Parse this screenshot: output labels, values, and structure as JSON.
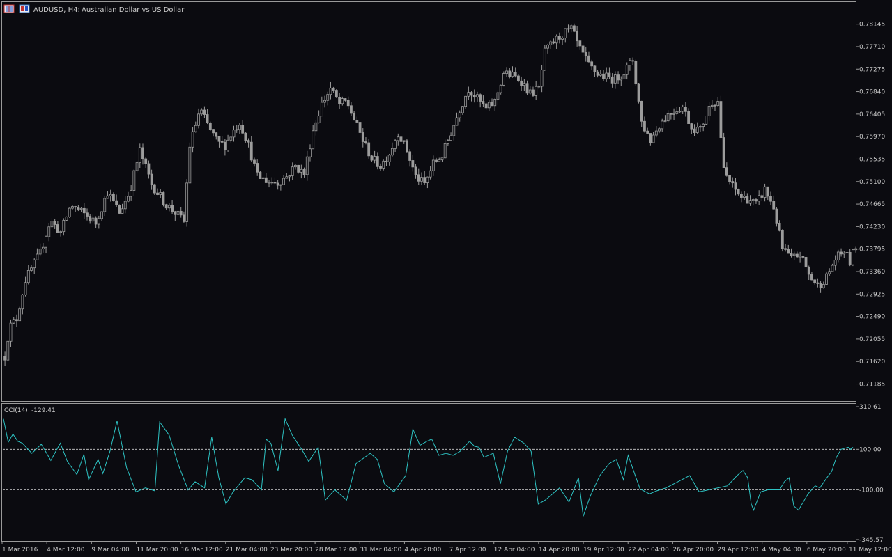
{
  "header": {
    "symbol_timeframe": "AUDUSD, H4:",
    "description": "Australian Dollar vs US Dollar",
    "icons": [
      "chart-grid-icon",
      "one-click-trading-icon"
    ]
  },
  "indicator": {
    "name": "CCI(14)",
    "value": "-129.41"
  },
  "colors": {
    "background": "#0b0b10",
    "candle": "#9c9c9c",
    "cci_line": "#2ec4c4",
    "levels": "#d0d0d0",
    "text": "#c8c8c8",
    "border": "#9a9a9a"
  },
  "chart_data": [
    {
      "type": "candlestick",
      "symbol": "AUDUSD",
      "timeframe": "H4",
      "price_axis_ticks": [
        "0.78145",
        "0.77710",
        "0.77275",
        "0.76840",
        "0.76405",
        "0.75970",
        "0.75535",
        "0.75100",
        "0.74665",
        "0.74230",
        "0.73795",
        "0.73360",
        "0.72925",
        "0.72490",
        "0.72055",
        "0.71620",
        "0.71185"
      ],
      "time_axis_ticks": [
        "1 Mar 2016",
        "4 Mar 12:00",
        "9 Mar 04:00",
        "11 Mar 20:00",
        "16 Mar 12:00",
        "21 Mar 04:00",
        "23 Mar 20:00",
        "28 Mar 12:00",
        "31 Mar 04:00",
        "4 Apr 20:00",
        "7 Apr 12:00",
        "12 Apr 04:00",
        "14 Apr 20:00",
        "19 Apr 12:00",
        "22 Apr 04:00",
        "26 Apr 20:00",
        "29 Apr 12:00",
        "4 May 04:00",
        "6 May 20:00",
        "11 May 12:00"
      ],
      "ylim": [
        0.7099,
        0.7845
      ],
      "close_path": [
        [
          0,
          0.7172
        ],
        [
          3,
          0.7228
        ],
        [
          8,
          0.7245
        ],
        [
          14,
          0.732
        ],
        [
          24,
          0.7372
        ],
        [
          31,
          0.7435
        ],
        [
          38,
          0.7412
        ],
        [
          45,
          0.7465
        ],
        [
          55,
          0.7445
        ],
        [
          62,
          0.743
        ],
        [
          70,
          0.749
        ],
        [
          78,
          0.745
        ],
        [
          85,
          0.749
        ],
        [
          92,
          0.757
        ],
        [
          100,
          0.7505
        ],
        [
          110,
          0.7465
        ],
        [
          118,
          0.7445
        ],
        [
          122,
          0.7432
        ],
        [
          126,
          0.758
        ],
        [
          133,
          0.765
        ],
        [
          138,
          0.762
        ],
        [
          145,
          0.7585
        ],
        [
          150,
          0.758
        ],
        [
          155,
          0.7605
        ],
        [
          160,
          0.7625
        ],
        [
          165,
          0.759
        ],
        [
          172,
          0.752
        ],
        [
          180,
          0.751
        ],
        [
          186,
          0.7508
        ],
        [
          192,
          0.752
        ],
        [
          198,
          0.754
        ],
        [
          204,
          0.7525
        ],
        [
          210,
          0.761
        ],
        [
          216,
          0.766
        ],
        [
          222,
          0.769
        ],
        [
          228,
          0.766
        ],
        [
          233,
          0.7665
        ],
        [
          238,
          0.763
        ],
        [
          244,
          0.759
        ],
        [
          250,
          0.7555
        ],
        [
          256,
          0.754
        ],
        [
          262,
          0.7565
        ],
        [
          268,
          0.7605
        ],
        [
          274,
          0.757
        ],
        [
          280,
          0.752
        ],
        [
          286,
          0.7505
        ],
        [
          292,
          0.7545
        ],
        [
          298,
          0.756
        ],
        [
          304,
          0.7605
        ],
        [
          310,
          0.765
        ],
        [
          316,
          0.769
        ],
        [
          322,
          0.767
        ],
        [
          328,
          0.765
        ],
        [
          334,
          0.7665
        ],
        [
          340,
          0.772
        ],
        [
          346,
          0.7715
        ],
        [
          352,
          0.7705
        ],
        [
          358,
          0.768
        ],
        [
          364,
          0.769
        ],
        [
          368,
          0.776
        ],
        [
          374,
          0.778
        ],
        [
          380,
          0.7795
        ],
        [
          386,
          0.7805
        ],
        [
          392,
          0.7765
        ],
        [
          398,
          0.7735
        ],
        [
          404,
          0.7718
        ],
        [
          410,
          0.7712
        ],
        [
          416,
          0.7708
        ],
        [
          422,
          0.7722
        ],
        [
          428,
          0.7745
        ],
        [
          434,
          0.7625
        ],
        [
          440,
          0.759
        ],
        [
          446,
          0.762
        ],
        [
          452,
          0.764
        ],
        [
          458,
          0.765
        ],
        [
          462,
          0.7655
        ],
        [
          468,
          0.7615
        ],
        [
          474,
          0.761
        ],
        [
          478,
          0.764
        ],
        [
          482,
          0.7665
        ],
        [
          486,
          0.7665
        ],
        [
          490,
          0.753
        ],
        [
          496,
          0.75
        ],
        [
          502,
          0.748
        ],
        [
          508,
          0.7475
        ],
        [
          512,
          0.7465
        ],
        [
          518,
          0.7495
        ],
        [
          524,
          0.746
        ],
        [
          530,
          0.738
        ],
        [
          536,
          0.736
        ],
        [
          542,
          0.737
        ],
        [
          548,
          0.733
        ],
        [
          554,
          0.7308
        ],
        [
          560,
          0.7325
        ],
        [
          566,
          0.736
        ],
        [
          572,
          0.7375
        ],
        [
          576,
          0.7355
        ],
        [
          580,
          0.7385
        ]
      ]
    },
    {
      "type": "line",
      "name": "CCI(14)",
      "last_value": -129.41,
      "ylim": [
        -345.57,
        310.61
      ],
      "axis_ticks": [
        "310.61",
        "100.00",
        "-100.00",
        "-345.57"
      ],
      "levels": [
        100,
        -100
      ],
      "series_path": [
        [
          0,
          250
        ],
        [
          4,
          135
        ],
        [
          8,
          175
        ],
        [
          12,
          140
        ],
        [
          16,
          130
        ],
        [
          24,
          80
        ],
        [
          32,
          125
        ],
        [
          40,
          45
        ],
        [
          48,
          130
        ],
        [
          54,
          40
        ],
        [
          62,
          -25
        ],
        [
          68,
          75
        ],
        [
          72,
          -50
        ],
        [
          80,
          50
        ],
        [
          84,
          -20
        ],
        [
          90,
          90
        ],
        [
          96,
          240
        ],
        [
          104,
          10
        ],
        [
          112,
          -110
        ],
        [
          120,
          -90
        ],
        [
          128,
          -105
        ],
        [
          132,
          235
        ],
        [
          140,
          170
        ],
        [
          148,
          20
        ],
        [
          156,
          -100
        ],
        [
          162,
          -60
        ],
        [
          170,
          -90
        ],
        [
          176,
          160
        ],
        [
          182,
          -40
        ],
        [
          188,
          -170
        ],
        [
          194,
          -110
        ],
        [
          204,
          -40
        ],
        [
          210,
          -50
        ],
        [
          218,
          -100
        ],
        [
          222,
          150
        ],
        [
          226,
          130
        ],
        [
          232,
          -5
        ],
        [
          238,
          250
        ],
        [
          244,
          170
        ],
        [
          252,
          100
        ],
        [
          258,
          40
        ],
        [
          266,
          110
        ],
        [
          272,
          -150
        ],
        [
          280,
          -100
        ],
        [
          290,
          -150
        ],
        [
          298,
          30
        ],
        [
          310,
          80
        ],
        [
          316,
          50
        ],
        [
          322,
          -70
        ],
        [
          330,
          -110
        ],
        [
          340,
          -30
        ],
        [
          346,
          200
        ],
        [
          352,
          120
        ],
        [
          358,
          140
        ],
        [
          362,
          150
        ],
        [
          368,
          70
        ],
        [
          374,
          80
        ],
        [
          380,
          70
        ],
        [
          386,
          90
        ],
        [
          394,
          140
        ],
        [
          398,
          115
        ],
        [
          402,
          110
        ],
        [
          406,
          60
        ],
        [
          414,
          80
        ],
        [
          420,
          -70
        ],
        [
          426,
          90
        ],
        [
          432,
          160
        ],
        [
          440,
          130
        ],
        [
          446,
          90
        ],
        [
          452,
          -170
        ],
        [
          458,
          -150
        ],
        [
          470,
          -90
        ],
        [
          478,
          -160
        ],
        [
          486,
          -40
        ],
        [
          490,
          -230
        ],
        [
          496,
          -130
        ],
        [
          504,
          -30
        ],
        [
          512,
          30
        ],
        [
          518,
          50
        ],
        [
          524,
          -50
        ],
        [
          528,
          70
        ],
        [
          534,
          -30
        ],
        [
          538,
          -95
        ],
        [
          546,
          -120
        ],
        [
          552,
          -105
        ],
        [
          560,
          -90
        ],
        [
          570,
          -60
        ],
        [
          580,
          -30
        ],
        [
          588,
          -110
        ],
        [
          596,
          -100
        ],
        [
          604,
          -90
        ],
        [
          612,
          -80
        ],
        [
          620,
          -30
        ],
        [
          625,
          -5
        ],
        [
          629,
          -40
        ],
        [
          632,
          -170
        ],
        [
          634,
          -200
        ],
        [
          640,
          -110
        ],
        [
          646,
          -100
        ],
        [
          652,
          -100
        ],
        [
          656,
          -100
        ],
        [
          660,
          -60
        ],
        [
          664,
          -40
        ],
        [
          668,
          -180
        ],
        [
          672,
          -200
        ],
        [
          680,
          -120
        ],
        [
          686,
          -80
        ],
        [
          690,
          -90
        ],
        [
          696,
          -40
        ],
        [
          700,
          -10
        ],
        [
          704,
          60
        ],
        [
          708,
          100
        ],
        [
          714,
          110
        ],
        [
          716,
          100
        ],
        [
          718,
          110
        ]
      ]
    }
  ]
}
